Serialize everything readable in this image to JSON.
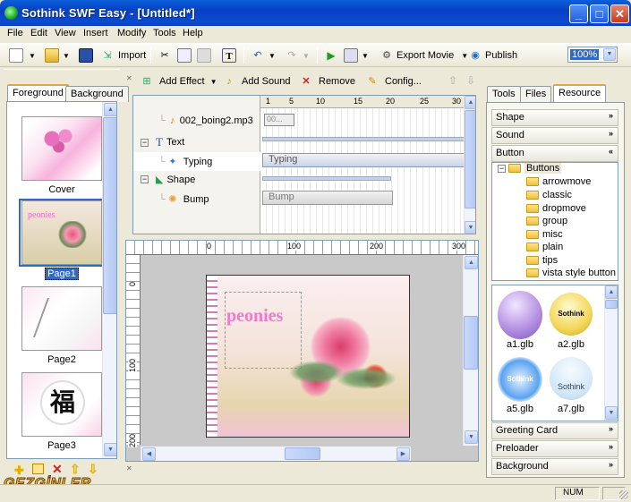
{
  "window": {
    "title": "Sothink SWF Easy - [Untitled*]",
    "min": "_",
    "max": "□",
    "close": "✕"
  },
  "menu": [
    "File",
    "Edit",
    "View",
    "Insert",
    "Modify",
    "Tools",
    "Help"
  ],
  "toolbar": {
    "import": "Import",
    "export": "Export Movie",
    "publish": "Publish",
    "zoom": "100%"
  },
  "left": {
    "tabs": [
      "Foreground",
      "Background"
    ],
    "pages": [
      {
        "label": "Cover"
      },
      {
        "label": "Page1"
      },
      {
        "label": "Page2"
      },
      {
        "label": "Page3"
      }
    ]
  },
  "timeline": {
    "toolbar": {
      "add_effect": "Add Effect",
      "add_sound": "Add Sound",
      "remove": "Remove",
      "config": "Config..."
    },
    "ruler": [
      "1",
      "5",
      "10",
      "15",
      "20",
      "25",
      "30"
    ],
    "rows": [
      {
        "label": "002_boing2.mp3",
        "bar": "00..."
      },
      {
        "label": "Text"
      },
      {
        "label": "Typing",
        "bar": "Typing"
      },
      {
        "label": "Shape"
      },
      {
        "label": "Bump",
        "bar": "Bump"
      }
    ]
  },
  "stage": {
    "ruler_h": [
      "0",
      "100",
      "200",
      "300"
    ],
    "ruler_v": [
      "0",
      "100",
      "200"
    ],
    "canvas_text": "peonies"
  },
  "right": {
    "tabs": [
      "Tools",
      "Files",
      "Resource"
    ],
    "sections": [
      "Shape",
      "Sound",
      "Button"
    ],
    "tree": {
      "root": "Buttons",
      "children": [
        "arrowmove",
        "classic",
        "dropmove",
        "group",
        "misc",
        "plain",
        "tips",
        "vista style button"
      ]
    },
    "glbs": [
      {
        "label": "a1.glb"
      },
      {
        "label": "a2.glb",
        "text": "Sothink"
      },
      {
        "label": "a5.glb",
        "text": "Sothink"
      },
      {
        "label": "a7.glb",
        "text": "Sothink"
      }
    ],
    "bottom_sections": [
      "Greeting Card",
      "Preloader",
      "Background"
    ]
  },
  "status": {
    "num": "NUM"
  },
  "watermark": "GEZGİNLER",
  "colors": {
    "title": "#0a4bd0",
    "tab_accent": "#e8a33b",
    "selection": "#316ac5"
  }
}
